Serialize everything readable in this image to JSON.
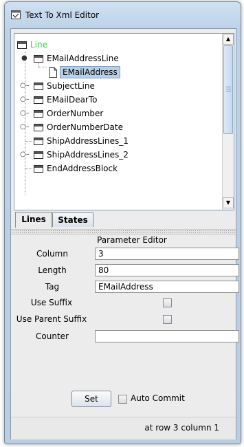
{
  "window": {
    "title": "Text To Xml Editor"
  },
  "tree": {
    "items": [
      {
        "label": "Line",
        "color": "#33cc33"
      },
      {
        "label": "EMailAddressLine"
      },
      {
        "label": "EMailAddress"
      },
      {
        "label": "SubjectLine"
      },
      {
        "label": "EMailDearTo"
      },
      {
        "label": "OrderNumber"
      },
      {
        "label": "OrderNumberDate"
      },
      {
        "label": "ShipAddressLines_1"
      },
      {
        "label": "ShipAddressLines_2"
      },
      {
        "label": "EndAddressBlock"
      }
    ],
    "scroll_up_icon": "arrow-up-icon",
    "scroll_down_icon": "arrow-down-icon"
  },
  "tabs": [
    {
      "label": "Lines"
    },
    {
      "label": "States"
    }
  ],
  "param_editor": {
    "heading": "Parameter Editor",
    "column_label": "Column",
    "column_value": "3",
    "length_label": "Length",
    "length_value": "80",
    "tag_label": "Tag",
    "tag_value": "EMailAddress",
    "use_suffix_label": "Use Suffix",
    "use_parent_suffix_label": "Use Parent Suffix",
    "counter_label": "Counter",
    "counter_value": ""
  },
  "actions": {
    "set_label": "Set",
    "auto_commit_label": "Auto Commit"
  },
  "status": {
    "text": "at row 3 column 1"
  }
}
